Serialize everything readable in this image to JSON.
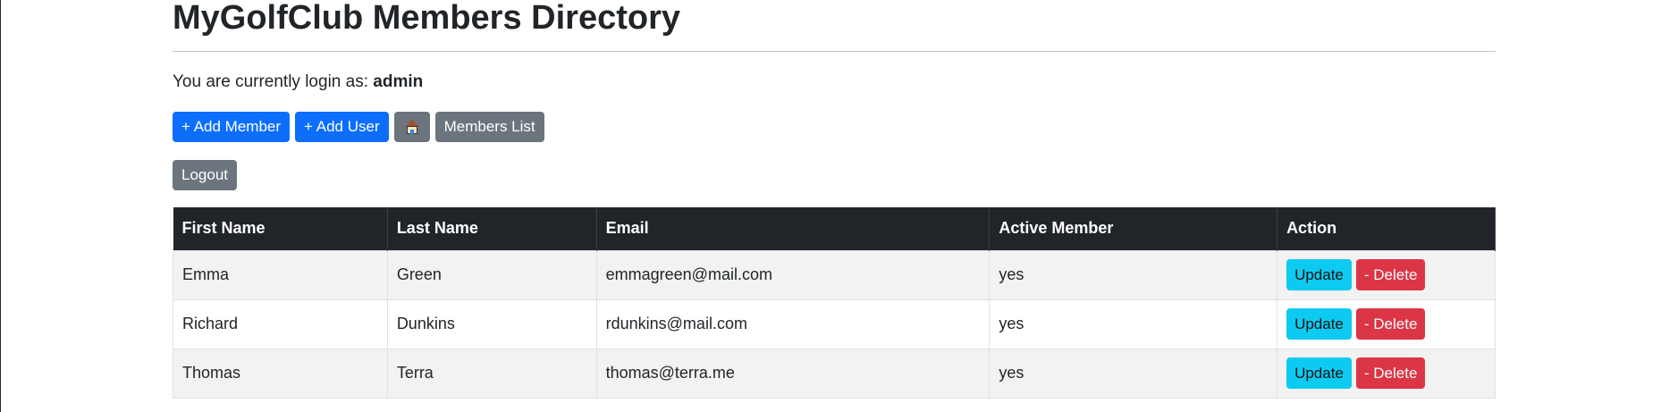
{
  "page": {
    "title": "MyGolfClub Members Directory",
    "login_prefix": "You are currently login as: ",
    "login_user": "admin"
  },
  "toolbar": {
    "add_member_label": "+ Add Member",
    "add_user_label": "+ Add User",
    "home_icon": "house-icon",
    "members_list_label": "Members List",
    "logout_label": "Logout"
  },
  "colors": {
    "primary": "#0d6efd",
    "secondary": "#6c757d",
    "info": "#0dcaf0",
    "danger": "#dc3545",
    "table_header": "#212529"
  },
  "table": {
    "headers": [
      "First Name",
      "Last Name",
      "Email",
      "Active Member",
      "Action"
    ],
    "rows": [
      {
        "first_name": "Emma",
        "last_name": "Green",
        "email": "emmagreen@mail.com",
        "active": "yes"
      },
      {
        "first_name": "Richard",
        "last_name": "Dunkins",
        "email": "rdunkins@mail.com",
        "active": "yes"
      },
      {
        "first_name": "Thomas",
        "last_name": "Terra",
        "email": "thomas@terra.me",
        "active": "yes"
      }
    ],
    "update_label": "Update",
    "delete_label": "- Delete"
  }
}
